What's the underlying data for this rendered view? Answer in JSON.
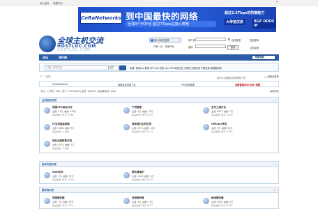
{
  "topbar": {
    "items": [
      "设为首页",
      "收藏本站"
    ]
  },
  "banner": {
    "brand": "CeRaNetworks",
    "headline": "到中国最快的网络",
    "sub": "全球9个POP点 超过7Tbps总接入带宽",
    "right1": "超过2.5Tbps的防御能力",
    "right2": "大带宽优质",
    "right3": "BGP DDOS IP"
  },
  "logo": {
    "cn": "全球主机交流",
    "en": "HOSTLOC.COM",
    "en_reflect": "HOSTLOC.COM"
  },
  "login": {
    "qq_label": "用QQ帐号登录",
    "reg_text": "只需一步，快速开始",
    "username_label": "用户名",
    "password_label": "密码",
    "auto_login": "自动登录",
    "find_pw": "找回密码",
    "login_btn": "登录",
    "register": "立即注册"
  },
  "nav": {
    "items": [
      "论坛",
      "排行榜"
    ],
    "fast": "快捷导航"
  },
  "search": {
    "placeholder": "请输入搜索内容",
    "type": "帖子",
    "hot_label": "热搜:",
    "hot": "香港vps 香港 VPS xen 机房 vps VPS 域名出售 大带宽 无限流量 不限流量 香港服务器"
  },
  "breadcrumb": {
    "home": "论坛",
    "sep": "›",
    "current": "论坛",
    "switch": "切换到宽版"
  },
  "notice": {
    "items": [
      "6月21日起禁止发布商业广告",
      "2019-7-12"
    ],
    "links": [
      "CeraNetworks",
      "网络监控测速工具",
      "VPS测评数据",
      "全新香港CN2 BGP 线路"
    ]
  },
  "stats": {
    "today": "今日: 1",
    "yesterday": "昨日: 284",
    "posts": "帖子: 12030406",
    "members": "会员: 148020",
    "newest": "欢迎新会员: bdfo",
    "new_threads": "最新回复"
  },
  "sections": [
    {
      "title": "主机综合交流",
      "forums": [
        {
          "name": "美国VPS综合讨论",
          "l2": "主题: 11万, 帖数: 149万",
          "l3": "最后发表: 昨天 23:48"
        },
        {
          "name": "干货整理",
          "l2": "主题: 1万, 帖数: 12万",
          "l3": "最后发表: 昨天 13:20"
        },
        {
          "name": "支付工具讨论",
          "l2": "主题: 6617, 帖数: 7万",
          "l3": "最后发表: 前天 10:28"
        },
        {
          "name": "IP主机值高网络",
          "l2": "主题: 2428, 帖数: 9万",
          "l3": "最后发表: 4 天前"
        },
        {
          "name": "商家建价主机交流",
          "l2": "主题: 2971, 帖数: 12万",
          "l3": "最后发表: 昨天 21:24"
        },
        {
          "name": "Offtopic专区",
          "l2": "主题: 1万, 帖数: 62万",
          "l3": "最后发表: 昨天 21:49"
        },
        {
          "name": "域名注册转售交流",
          "l2": "主题: 4074, 帖数: 7万",
          "l3": "最后发表: 3 天前"
        }
      ]
    },
    {
      "title": "技术交流分享",
      "forums": [
        {
          "name": "Web技术",
          "l2": "主题: 1万, 帖数: 19万",
          "l3": "最后发表: 昨天 21:28"
        },
        {
          "name": "服务器维护",
          "l2": "主题: 1523, 帖数: 3万",
          "l3": "最后发表: 昨天 18:20"
        }
      ]
    },
    {
      "title": "服务商讨论",
      "forums": [
        {
          "name": "美国服务器",
          "l2": "主题: 7万, 帖数: 39万",
          "l3": "最后发表: 昨天 22:14"
        },
        {
          "name": "亚洲服务器",
          "l2": "主题: 1万, 帖数: 11万",
          "l3": "最后发表: 昨天 16:51"
        },
        {
          "name": "欧洲服务器",
          "l2": "主题: 3594, 帖数: 2万",
          "l3": "最后发表: 昨天 20:44"
        }
      ]
    }
  ],
  "colors": {
    "nav": "#2b5da8",
    "banner": "#2962e0",
    "link": "#2b5da8"
  }
}
